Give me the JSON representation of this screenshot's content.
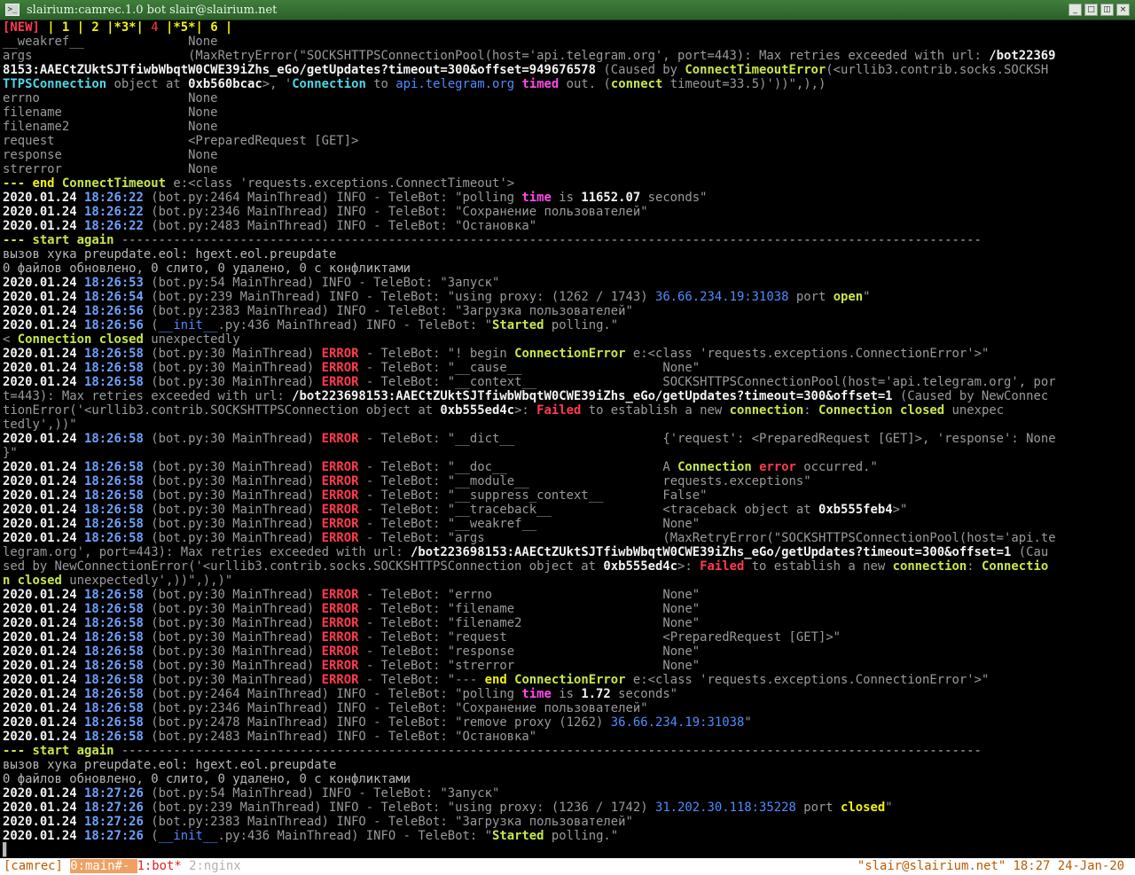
{
  "window": {
    "title": "slairium:camrec.1.0 bot slair@slairium.net",
    "icon": "terminal-icon",
    "buttons": [
      "minimize-icon",
      "maximize-icon",
      "restore-icon",
      "close-icon"
    ]
  },
  "terminal": {
    "lines": [
      [
        [
          "r",
          "[NEW]"
        ],
        [
          "y",
          " | 1 | 2 |*3*| "
        ],
        [
          "rn",
          "4"
        ],
        [
          "y",
          " |*5*| 6 |"
        ]
      ],
      [
        [
          "gr",
          "__weakref__              None"
        ]
      ],
      [
        [
          "gr",
          "args                     (MaxRetryError(\"SOCKSHTTPSConnectionPool(host='api.telegram.org', port=443): Max retries exceeded with url: "
        ],
        [
          "w",
          "/bot22369"
        ]
      ],
      [
        [
          "w",
          "8153:AAECtZUktSJTfiwbWbqtW0CWE39iZhs_eGo/getUpdates?timeout=300&offset=949676578"
        ],
        [
          "gr",
          " (Caused by "
        ],
        [
          "yg",
          "ConnectTimeoutError"
        ],
        [
          "gr",
          "(<urllib3.contrib.socks.SOCKSH"
        ]
      ],
      [
        [
          "c",
          "TTPSConnection"
        ],
        [
          "gr",
          " object at "
        ],
        [
          "w",
          "0xb560bcac"
        ],
        [
          "gr",
          ">, '"
        ],
        [
          "c",
          "Connection"
        ],
        [
          "gr",
          " to "
        ],
        [
          "b",
          "api.telegram.org"
        ],
        [
          "gr",
          " "
        ],
        [
          "m",
          "timed"
        ],
        [
          "gr",
          " out. ("
        ],
        [
          "yg",
          "connect"
        ],
        [
          "gr",
          " timeout=33.5)'))\",),)"
        ]
      ],
      [
        [
          "gr",
          "errno                    None"
        ]
      ],
      [
        [
          "gr",
          "filename                 None"
        ]
      ],
      [
        [
          "gr",
          "filename2                None"
        ]
      ],
      [
        [
          "gr",
          "request                  <PreparedRequest [GET]>"
        ]
      ],
      [
        [
          "gr",
          "response                 None"
        ]
      ],
      [
        [
          "gr",
          "strerror                 None"
        ]
      ],
      [
        [
          "yg",
          "--- "
        ],
        [
          "y",
          "end"
        ],
        [
          "yg",
          " ConnectTimeout"
        ],
        [
          "gr",
          " e:<class 'requests.exceptions.ConnectTimeout'>"
        ]
      ],
      [
        [
          "w",
          "2020.01.24 "
        ],
        [
          "bb",
          "18:26:22"
        ],
        [
          "gr",
          " (bot.py:2464 MainThread) INFO - TeleBot: \"polling "
        ],
        [
          "m",
          "time"
        ],
        [
          "gr",
          " is "
        ],
        [
          "w",
          "11652.07"
        ],
        [
          "gr",
          " seconds\""
        ]
      ],
      [
        [
          "w",
          "2020.01.24 "
        ],
        [
          "bb",
          "18:26:22"
        ],
        [
          "gr",
          " (bot.py:2346 MainThread) INFO - TeleBot: \"Сохранение пользователей\""
        ]
      ],
      [
        [
          "w",
          "2020.01.24 "
        ],
        [
          "bb",
          "18:26:22"
        ],
        [
          "gr",
          " (bot.py:2483 MainThread) INFO - TeleBot: \"Остановка\""
        ]
      ],
      [
        [
          "yg",
          "--- start again "
        ],
        [
          "g",
          "--------------------------------------------------------------------------------------------------------------------"
        ]
      ],
      [
        [
          "g",
          "вызов хука preupdate.eol: hgext.eol.preupdate"
        ]
      ],
      [
        [
          "g",
          "0 файлов обновлено, 0 слито, 0 удалено, 0 с конфликтами"
        ]
      ],
      [
        [
          "w",
          "2020.01.24 "
        ],
        [
          "bb",
          "18:26:53"
        ],
        [
          "gr",
          " (bot.py:54 MainThread) INFO - TeleBot: \"Запуск\""
        ]
      ],
      [
        [
          "w",
          "2020.01.24 "
        ],
        [
          "bb",
          "18:26:54"
        ],
        [
          "gr",
          " (bot.py:239 MainThread) INFO - TeleBot: \"using proxy: (1262 / 1743) "
        ],
        [
          "b",
          "36.66.234.19:31038"
        ],
        [
          "gr",
          " port "
        ],
        [
          "yg",
          "open"
        ],
        [
          "gr",
          "\""
        ]
      ],
      [
        [
          "w",
          "2020.01.24 "
        ],
        [
          "bb",
          "18:26:56"
        ],
        [
          "gr",
          " (bot.py:2383 MainThread) INFO - TeleBot: \"Загрузка пользователей\""
        ]
      ],
      [
        [
          "w",
          "2020.01.24 "
        ],
        [
          "bb",
          "18:26:56"
        ],
        [
          "gr",
          " ("
        ],
        [
          "b",
          "__init__"
        ],
        [
          "gr",
          ".py:436 MainThread) INFO - TeleBot: \""
        ],
        [
          "yg",
          "Started"
        ],
        [
          "gr",
          " polling.\""
        ]
      ],
      [
        [
          "gr",
          "< "
        ],
        [
          "yg",
          "Connection closed"
        ],
        [
          "gr",
          " unexpectedly"
        ]
      ],
      [
        [
          "w",
          "2020.01.24 "
        ],
        [
          "bb",
          "18:26:58"
        ],
        [
          "gr",
          " (bot.py:30 MainThread) "
        ],
        [
          "r",
          "ERROR"
        ],
        [
          "gr",
          " - TeleBot: \"! begin "
        ],
        [
          "yg",
          "ConnectionError"
        ],
        [
          "gr",
          " e:<class 'requests.exceptions.ConnectionError'>\""
        ]
      ],
      [
        [
          "w",
          "2020.01.24 "
        ],
        [
          "bb",
          "18:26:58"
        ],
        [
          "gr",
          " (bot.py:30 MainThread) "
        ],
        [
          "r",
          "ERROR"
        ],
        [
          "gr",
          " - TeleBot: \"__cause__                   None\""
        ]
      ],
      [
        [
          "w",
          "2020.01.24 "
        ],
        [
          "bb",
          "18:26:58"
        ],
        [
          "gr",
          " (bot.py:30 MainThread) "
        ],
        [
          "r",
          "ERROR"
        ],
        [
          "gr",
          " - TeleBot: \"__context__                 SOCKSHTTPSConnectionPool(host='api.telegram.org', por"
        ]
      ],
      [
        [
          "gr",
          "t=443): Max retries exceeded with url: "
        ],
        [
          "w",
          "/bot223698153:AAECtZUktSJTfiwbWbqtW0CWE39iZhs_eGo/getUpdates?timeout=300&offset=1"
        ],
        [
          "gr",
          " (Caused by NewConnec"
        ]
      ],
      [
        [
          "gr",
          "tionError('<urllib3.contrib.SOCKSHTTPSConnection object at "
        ],
        [
          "w",
          "0xb555ed4c"
        ],
        [
          "gr",
          ">: "
        ],
        [
          "r",
          "Failed"
        ],
        [
          "gr",
          " to establish a new "
        ],
        [
          "yg",
          "connection"
        ],
        [
          "gr",
          ": "
        ],
        [
          "yg",
          "Connection closed"
        ],
        [
          "gr",
          " unexpec"
        ]
      ],
      [
        [
          "gr",
          "tedly',))\""
        ]
      ],
      [
        [
          "w",
          "2020.01.24 "
        ],
        [
          "bb",
          "18:26:58"
        ],
        [
          "gr",
          " (bot.py:30 MainThread) "
        ],
        [
          "r",
          "ERROR"
        ],
        [
          "gr",
          " - TeleBot: \"__dict__                    {'request': <PreparedRequest [GET]>, 'response': None"
        ]
      ],
      [
        [
          "gr",
          "}\""
        ]
      ],
      [
        [
          "w",
          "2020.01.24 "
        ],
        [
          "bb",
          "18:26:58"
        ],
        [
          "gr",
          " (bot.py:30 MainThread) "
        ],
        [
          "r",
          "ERROR"
        ],
        [
          "gr",
          " - TeleBot: \"__doc__                     A "
        ],
        [
          "yg",
          "Connection"
        ],
        [
          "gr",
          " "
        ],
        [
          "r",
          "error"
        ],
        [
          "gr",
          " occurred.\""
        ]
      ],
      [
        [
          "w",
          "2020.01.24 "
        ],
        [
          "bb",
          "18:26:58"
        ],
        [
          "gr",
          " (bot.py:30 MainThread) "
        ],
        [
          "r",
          "ERROR"
        ],
        [
          "gr",
          " - TeleBot: \"__module__                  requests.exceptions\""
        ]
      ],
      [
        [
          "w",
          "2020.01.24 "
        ],
        [
          "bb",
          "18:26:58"
        ],
        [
          "gr",
          " (bot.py:30 MainThread) "
        ],
        [
          "r",
          "ERROR"
        ],
        [
          "gr",
          " - TeleBot: \"__suppress_context__        False\""
        ]
      ],
      [
        [
          "w",
          "2020.01.24 "
        ],
        [
          "bb",
          "18:26:58"
        ],
        [
          "gr",
          " (bot.py:30 MainThread) "
        ],
        [
          "r",
          "ERROR"
        ],
        [
          "gr",
          " - TeleBot: \"__traceback__               <traceback object at "
        ],
        [
          "w",
          "0xb555feb4"
        ],
        [
          "gr",
          ">\""
        ]
      ],
      [
        [
          "w",
          "2020.01.24 "
        ],
        [
          "bb",
          "18:26:58"
        ],
        [
          "gr",
          " (bot.py:30 MainThread) "
        ],
        [
          "r",
          "ERROR"
        ],
        [
          "gr",
          " - TeleBot: \"__weakref__                 None\""
        ]
      ],
      [
        [
          "w",
          "2020.01.24 "
        ],
        [
          "bb",
          "18:26:58"
        ],
        [
          "gr",
          " (bot.py:30 MainThread) "
        ],
        [
          "r",
          "ERROR"
        ],
        [
          "gr",
          " - TeleBot: \"args                        (MaxRetryError(\"SOCKSHTTPSConnectionPool(host='api.te"
        ]
      ],
      [
        [
          "gr",
          "legram.org', port=443): Max retries exceeded with url: "
        ],
        [
          "w",
          "/bot223698153:AAECtZUktSJTfiwbWbqtW0CWE39iZhs_eGo/getUpdates?timeout=300&offset=1"
        ],
        [
          "gr",
          " (Cau"
        ]
      ],
      [
        [
          "gr",
          "sed by NewConnectionError('<urllib3.contrib.socks.SOCKSHTTPSConnection object at "
        ],
        [
          "w",
          "0xb555ed4c"
        ],
        [
          "gr",
          ">: "
        ],
        [
          "r",
          "Failed"
        ],
        [
          "gr",
          " to establish a new "
        ],
        [
          "yg",
          "connection"
        ],
        [
          "gr",
          ": "
        ],
        [
          "yg",
          "Connectio"
        ]
      ],
      [
        [
          "yg",
          "n closed"
        ],
        [
          "gr",
          " unexpectedly',))\",),)\""
        ]
      ],
      [
        [
          "w",
          "2020.01.24 "
        ],
        [
          "bb",
          "18:26:58"
        ],
        [
          "gr",
          " (bot.py:30 MainThread) "
        ],
        [
          "r",
          "ERROR"
        ],
        [
          "gr",
          " - TeleBot: \"errno                       None\""
        ]
      ],
      [
        [
          "w",
          "2020.01.24 "
        ],
        [
          "bb",
          "18:26:58"
        ],
        [
          "gr",
          " (bot.py:30 MainThread) "
        ],
        [
          "r",
          "ERROR"
        ],
        [
          "gr",
          " - TeleBot: \"filename                    None\""
        ]
      ],
      [
        [
          "w",
          "2020.01.24 "
        ],
        [
          "bb",
          "18:26:58"
        ],
        [
          "gr",
          " (bot.py:30 MainThread) "
        ],
        [
          "r",
          "ERROR"
        ],
        [
          "gr",
          " - TeleBot: \"filename2                   None\""
        ]
      ],
      [
        [
          "w",
          "2020.01.24 "
        ],
        [
          "bb",
          "18:26:58"
        ],
        [
          "gr",
          " (bot.py:30 MainThread) "
        ],
        [
          "r",
          "ERROR"
        ],
        [
          "gr",
          " - TeleBot: \"request                     <PreparedRequest [GET]>\""
        ]
      ],
      [
        [
          "w",
          "2020.01.24 "
        ],
        [
          "bb",
          "18:26:58"
        ],
        [
          "gr",
          " (bot.py:30 MainThread) "
        ],
        [
          "r",
          "ERROR"
        ],
        [
          "gr",
          " - TeleBot: \"response                    None\""
        ]
      ],
      [
        [
          "w",
          "2020.01.24 "
        ],
        [
          "bb",
          "18:26:58"
        ],
        [
          "gr",
          " (bot.py:30 MainThread) "
        ],
        [
          "r",
          "ERROR"
        ],
        [
          "gr",
          " - TeleBot: \"strerror                    None\""
        ]
      ],
      [
        [
          "w",
          "2020.01.24 "
        ],
        [
          "bb",
          "18:26:58"
        ],
        [
          "gr",
          " (bot.py:30 MainThread) "
        ],
        [
          "r",
          "ERROR"
        ],
        [
          "gr",
          " - TeleBot: \"--- "
        ],
        [
          "y",
          "end"
        ],
        [
          "yg",
          " ConnectionError"
        ],
        [
          "gr",
          " e:<class 'requests.exceptions.ConnectionError'>\""
        ]
      ],
      [
        [
          "w",
          "2020.01.24 "
        ],
        [
          "bb",
          "18:26:58"
        ],
        [
          "gr",
          " (bot.py:2464 MainThread) INFO - TeleBot: \"polling "
        ],
        [
          "m",
          "time"
        ],
        [
          "gr",
          " is "
        ],
        [
          "w",
          "1.72"
        ],
        [
          "gr",
          " seconds\""
        ]
      ],
      [
        [
          "w",
          "2020.01.24 "
        ],
        [
          "bb",
          "18:26:58"
        ],
        [
          "gr",
          " (bot.py:2346 MainThread) INFO - TeleBot: \"Сохранение пользователей\""
        ]
      ],
      [
        [
          "w",
          "2020.01.24 "
        ],
        [
          "bb",
          "18:26:58"
        ],
        [
          "gr",
          " (bot.py:2478 MainThread) INFO - TeleBot: \"remove proxy (1262) "
        ],
        [
          "b",
          "36.66.234.19:31038"
        ],
        [
          "gr",
          "\""
        ]
      ],
      [
        [
          "w",
          "2020.01.24 "
        ],
        [
          "bb",
          "18:26:58"
        ],
        [
          "gr",
          " (bot.py:2483 MainThread) INFO - TeleBot: \"Остановка\""
        ]
      ],
      [
        [
          "yg",
          "--- start again "
        ],
        [
          "g",
          "--------------------------------------------------------------------------------------------------------------------"
        ]
      ],
      [
        [
          "g",
          "вызов хука preupdate.eol: hgext.eol.preupdate"
        ]
      ],
      [
        [
          "g",
          "0 файлов обновлено, 0 слито, 0 удалено, 0 с конфликтами"
        ]
      ],
      [
        [
          "w",
          "2020.01.24 "
        ],
        [
          "bb",
          "18:27:26"
        ],
        [
          "gr",
          " (bot.py:54 MainThread) INFO - TeleBot: \"Запуск\""
        ]
      ],
      [
        [
          "w",
          "2020.01.24 "
        ],
        [
          "bb",
          "18:27:26"
        ],
        [
          "gr",
          " (bot.py:239 MainThread) INFO - TeleBot: \"using proxy: (1236 / 1742) "
        ],
        [
          "b",
          "31.202.30.118:35228"
        ],
        [
          "gr",
          " port "
        ],
        [
          "y",
          "closed"
        ],
        [
          "gr",
          "\""
        ]
      ],
      [
        [
          "w",
          "2020.01.24 "
        ],
        [
          "bb",
          "18:27:26"
        ],
        [
          "gr",
          " (bot.py:2383 MainThread) INFO - TeleBot: \"Загрузка пользователей\""
        ]
      ],
      [
        [
          "w",
          "2020.01.24 "
        ],
        [
          "bb",
          "18:27:26"
        ],
        [
          "gr",
          " ("
        ],
        [
          "b",
          "__init__"
        ],
        [
          "gr",
          ".py:436 MainThread) INFO - TeleBot: \""
        ],
        [
          "yg",
          "Started"
        ],
        [
          "gr",
          " polling.\""
        ]
      ],
      [
        [
          "g",
          "▌"
        ]
      ]
    ]
  },
  "statusbar": {
    "session": "[camrec] ",
    "win0": "0:main#- ",
    "win1": "1:bot* ",
    "win2": "2:nginx",
    "right": "\"slair@slairium.net\" 18:27 24-Jan-20"
  }
}
